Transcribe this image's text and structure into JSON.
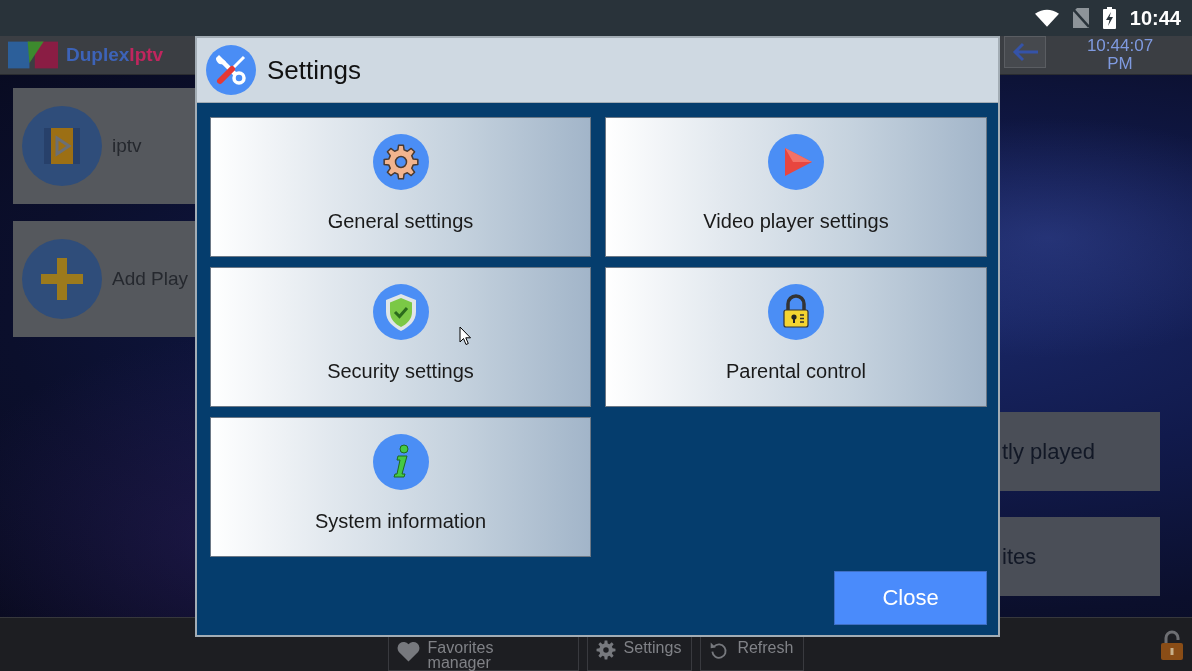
{
  "status_bar": {
    "time": "10:44"
  },
  "app_header": {
    "logo": {
      "part_1": "Duplex",
      "part_2": "Iptv"
    },
    "clock": {
      "time": "10:44:07",
      "period": "PM"
    }
  },
  "playlists": [
    {
      "kind": "playlist",
      "label": "iptv"
    },
    {
      "kind": "add",
      "label": "Add Play"
    }
  ],
  "quick_actions": [
    {
      "label": "tly played"
    },
    {
      "label": "ites"
    }
  ],
  "bottom_bar": [
    {
      "kind": "favorites",
      "label": "Favorites manager"
    },
    {
      "kind": "settings",
      "label": "Settings"
    },
    {
      "kind": "refresh",
      "label": "Refresh"
    }
  ],
  "dialog": {
    "title": "Settings",
    "options": [
      {
        "kind": "general",
        "label": "General settings"
      },
      {
        "kind": "video",
        "label": "Video player settings"
      },
      {
        "kind": "security",
        "label": "Security settings"
      },
      {
        "kind": "parental",
        "label": "Parental control"
      },
      {
        "kind": "info",
        "label": "System information"
      }
    ],
    "close_button": "Close"
  }
}
